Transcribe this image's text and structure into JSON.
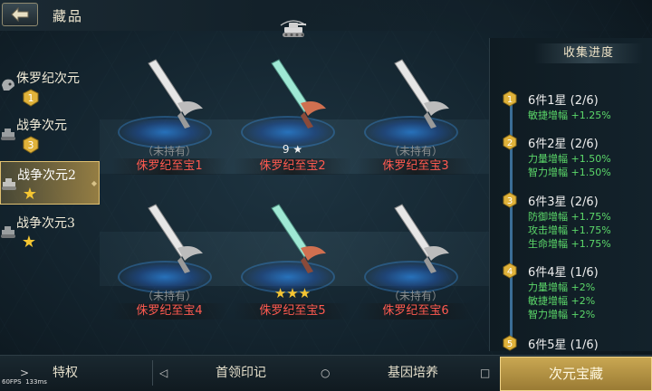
{
  "header": {
    "title": "藏品"
  },
  "sidebar": {
    "items": [
      {
        "label": "侏罗纪次元",
        "badge": "1",
        "badge_kind": "number"
      },
      {
        "label": "战争次元",
        "badge": "3",
        "badge_kind": "number"
      },
      {
        "label": "战争次元2",
        "badge": "★",
        "badge_kind": "star",
        "active": true
      },
      {
        "label": "战争次元3",
        "badge": "★",
        "badge_kind": "star"
      }
    ]
  },
  "items": [
    {
      "name": "侏罗纪至宝1",
      "status": "（未持有）",
      "owned": false
    },
    {
      "name": "侏罗纪至宝2",
      "status": "9 ★",
      "owned": true
    },
    {
      "name": "侏罗纪至宝3",
      "status": "（未持有）",
      "owned": false
    },
    {
      "name": "侏罗纪至宝4",
      "status": "（未持有）",
      "owned": false
    },
    {
      "name": "侏罗纪至宝5",
      "status": "★★★",
      "owned": true
    },
    {
      "name": "侏罗纪至宝6",
      "status": "（未持有）",
      "owned": false
    }
  ],
  "progress": {
    "title": "收集进度",
    "groups": [
      {
        "num": "1",
        "head": "6件1星 (2/6)",
        "stats": [
          "敏捷增幅 +1.25%"
        ]
      },
      {
        "num": "2",
        "head": "6件2星 (2/6)",
        "stats": [
          "力量增幅 +1.50%",
          "智力增幅 +1.50%"
        ]
      },
      {
        "num": "3",
        "head": "6件3星 (2/6)",
        "stats": [
          "防御增幅 +1.75%",
          "攻击增幅 +1.75%",
          "生命增幅 +1.75%"
        ]
      },
      {
        "num": "4",
        "head": "6件4星 (1/6)",
        "stats": [
          "力量增幅 +2%",
          "敏捷增幅 +2%",
          "智力增幅 +2%"
        ]
      },
      {
        "num": "5",
        "head": "6件5星 (1/6)",
        "stats": []
      }
    ]
  },
  "bottom": {
    "tabs": [
      "特权",
      "首领印记",
      "基因培养",
      "次元宝藏"
    ],
    "icons": [
      ">",
      "◁",
      "○",
      "□"
    ],
    "active": "次元宝藏"
  },
  "debug": {
    "fps": "60FPS",
    "ms": "133ms"
  },
  "colors": {
    "accent": "#c9a752",
    "owned_name": "#ff5a50",
    "stat_green": "#5cd96a",
    "star": "#f5c632"
  }
}
